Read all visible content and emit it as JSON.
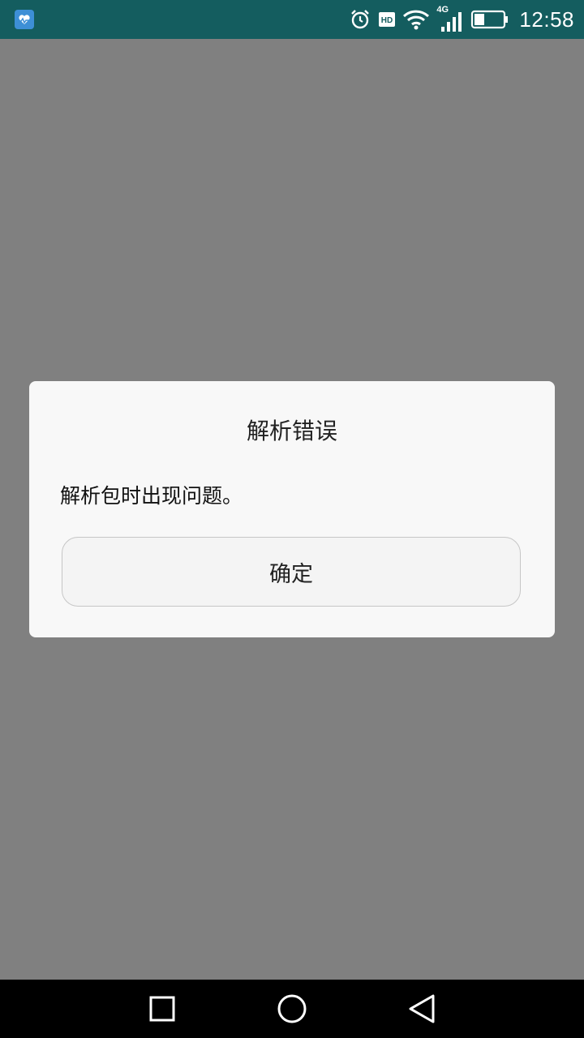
{
  "status_bar": {
    "time": "12:58",
    "network": "4G",
    "hd_label": "HD",
    "battery_level": 0.35,
    "icons": [
      "app-health-icon",
      "alarm-icon",
      "hd-icon",
      "wifi-icon",
      "signal-4g-icon",
      "battery-icon"
    ]
  },
  "dialog": {
    "title": "解析错误",
    "message": "解析包时出现问题。",
    "confirm_label": "确定"
  },
  "nav_bar": {
    "icons": [
      "recent-apps-icon",
      "home-icon",
      "back-icon"
    ]
  },
  "colors": {
    "status_bar": "#145d5f",
    "scrim": "#808080",
    "dialog_bg": "#f8f8f8",
    "nav_bar": "#000000"
  }
}
